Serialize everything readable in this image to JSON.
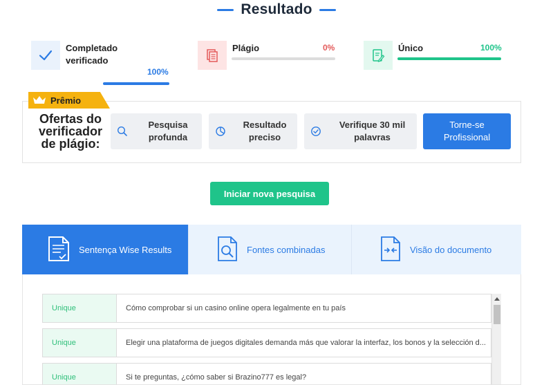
{
  "page": {
    "title": "Resultado"
  },
  "stats": [
    {
      "label_line1": "Completado",
      "label_line2": "verificado",
      "percent": "100%",
      "value": 100,
      "color": "#2b7be4",
      "icon": "check-icon"
    },
    {
      "label_line1": "Plágio",
      "percent": "0%",
      "value": 0,
      "color": "#e35a5a",
      "icon": "document-copy-icon"
    },
    {
      "label_line1": "Único",
      "percent": "100%",
      "value": 100,
      "color": "#1fc48a",
      "icon": "edit-document-icon"
    }
  ],
  "premium": {
    "tag": "Prêmio",
    "offers_title_line1": "Ofertas do",
    "offers_title_line2": "verificador",
    "offers_title_line3": "de plágio:",
    "offers": [
      {
        "line1": "Pesquisa",
        "line2": "profunda",
        "icon": "search-icon"
      },
      {
        "line1": "Resultado",
        "line2": "preciso",
        "icon": "pie-chart-icon"
      },
      {
        "line1": "Verifique 30 mil",
        "line2": "palavras",
        "icon": "check-circle-icon"
      }
    ],
    "pro_button_line1": "Torne-se",
    "pro_button_line2": "Profissional"
  },
  "new_search_label": "Iniciar nova pesquisa",
  "tabs": [
    {
      "label": "Sentença Wise Results",
      "active": true,
      "icon": "document-list-icon"
    },
    {
      "label": "Fontes combinadas",
      "active": false,
      "icon": "document-search-icon"
    },
    {
      "label": "Visão do documento",
      "active": false,
      "icon": "document-compare-icon"
    }
  ],
  "results": [
    {
      "status": "Unique",
      "sentence": "Cómo comprobar si un casino online opera legalmente en tu país"
    },
    {
      "status": "Unique",
      "sentence": "Elegir una plataforma de juegos digitales demanda más que valorar la interfaz, los bonos y la selección d..."
    },
    {
      "status": "Unique",
      "sentence": "Si te preguntas, ¿cómo saber si Brazino777 es legal?"
    }
  ],
  "colors": {
    "accent": "#2b7be4",
    "success": "#1fc48a",
    "danger": "#e35a5a",
    "premium": "#f5b20f"
  }
}
